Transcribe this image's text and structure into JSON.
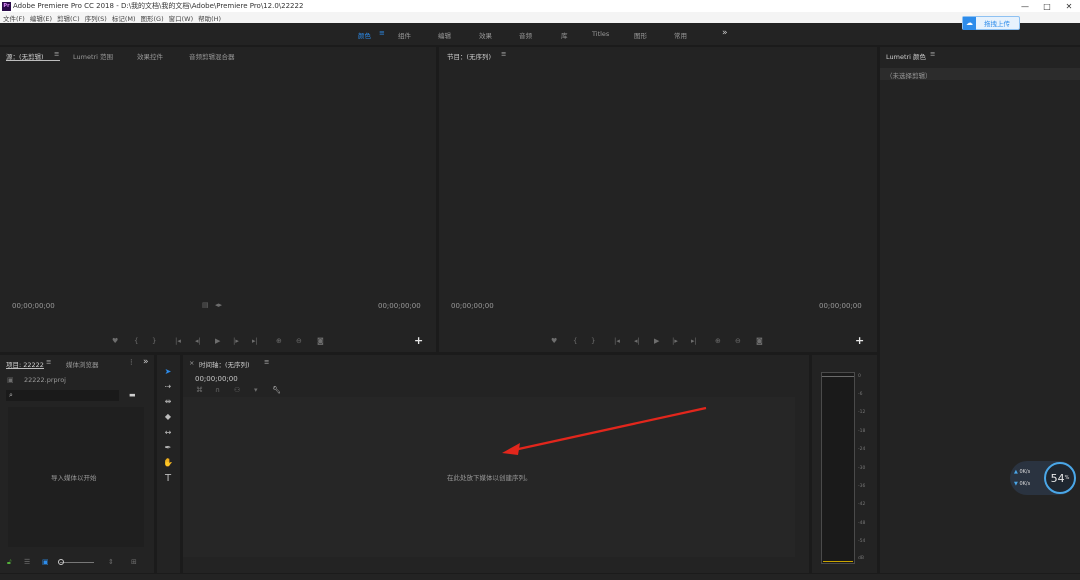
{
  "titlebar": {
    "logo": "Pr",
    "title": "Adobe Premiere Pro CC 2018 - D:\\我的文档\\我的文档\\Adobe\\Premiere Pro\\12.0\\22222",
    "minimize": "—",
    "maximize": "□",
    "close": "✕"
  },
  "menu": [
    "文件(F)",
    "编辑(E)",
    "剪辑(C)",
    "序列(S)",
    "标记(M)",
    "图形(G)",
    "窗口(W)",
    "帮助(H)"
  ],
  "workspaces": {
    "tabs": [
      "颜色",
      "组件",
      "编辑",
      "效果",
      "音频",
      "库",
      "Titles",
      "图形",
      "常用"
    ],
    "active": 0,
    "menu_glyph": "≡",
    "more": "»"
  },
  "upload": {
    "label": "拖拽上传"
  },
  "source_panel": {
    "tabs": [
      "源：(无剪辑)",
      "Lumetri 范围",
      "效果控件",
      "音频剪辑混合器"
    ],
    "menu_glyph": "≡",
    "timecode_left": "00;00;00;00",
    "timecode_right": "00;00;00;00",
    "plus": "+"
  },
  "program_panel": {
    "title": "节目：(无序列)",
    "menu_glyph": "≡",
    "timecode_left": "00;00;00;00",
    "timecode_right": "00;00;00;00",
    "plus": "+"
  },
  "lumetri_panel": {
    "title": "Lumetri 颜色",
    "menu_glyph": "≡",
    "status": "（未选择剪辑）"
  },
  "project_panel": {
    "tabs": [
      "项目: 22222",
      "媒体浏览器"
    ],
    "menu_glyph": "≡",
    "more": "»",
    "file": "22222.prproj",
    "hint": "导入媒体以开始",
    "footer_icons": [
      "list-view",
      "icon-view",
      "freeform-view",
      "zoom-slider",
      "sort"
    ]
  },
  "tools": [
    "selection",
    "track-select",
    "ripple-edit",
    "razor",
    "slip",
    "pen",
    "hand",
    "type"
  ],
  "timeline_panel": {
    "close": "×",
    "title": "时间轴：(无序列)",
    "menu_glyph": "≡",
    "timecode": "00;00;00;00",
    "hint": "在此处放下媒体以创建序列。"
  },
  "audio_meter": {
    "ticks": [
      "0",
      "-6",
      "-12",
      "-18",
      "-24",
      "-30",
      "-36",
      "-42",
      "-48",
      "-54",
      "dB"
    ]
  },
  "speed_widget": {
    "up": "0K/s",
    "down": "0K/s",
    "percent": "54",
    "unit": "%"
  },
  "colors": {
    "accent": "#2d8ceb",
    "arrow": "#e2261c",
    "panel": "#232323",
    "bg": "#1b1b1b"
  }
}
